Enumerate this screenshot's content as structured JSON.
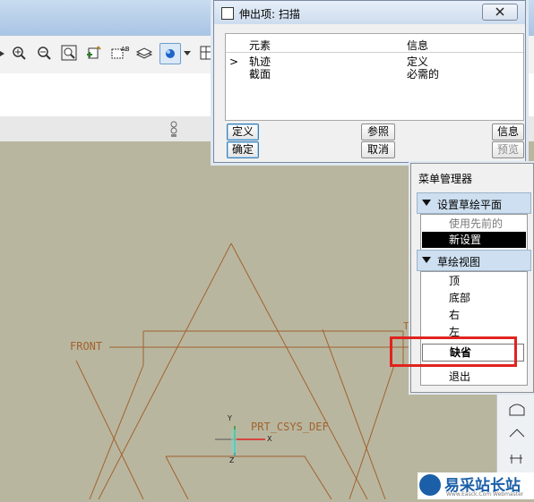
{
  "toolbar": {
    "icons": [
      "zoom-in-icon",
      "zoom-out-icon",
      "zoom-fit-icon",
      "reorient-icon",
      "named-views-icon",
      "layers-icon",
      "display-style-icon",
      "saved-views-icon"
    ]
  },
  "dialog": {
    "title": "伸出项: 扫描",
    "close_label": "关闭",
    "col_element": "元素",
    "col_info": "信息",
    "rows": [
      {
        "marker": ">",
        "element": "轨迹",
        "info": "定义"
      },
      {
        "marker": "",
        "element": "截面",
        "info": "必需的"
      }
    ],
    "buttons": {
      "define": "定义",
      "reference": "参照",
      "info": "信息",
      "ok": "确定",
      "cancel": "取消",
      "preview": "预览"
    }
  },
  "menu_manager": {
    "title": "菜单管理器",
    "section1": {
      "label": "设置草绘平面",
      "items": [
        "使用先前的",
        "新设置"
      ]
    },
    "section2": {
      "label": "草绘视图",
      "items": [
        "顶",
        "底部",
        "右",
        "左",
        "缺省"
      ]
    },
    "exit": "退出"
  },
  "viewport": {
    "datum_front": "FRONT",
    "datum_csys": "PRT_CSYS_DEF",
    "datum_t": "T",
    "axis_y": "Y",
    "axis_x": "X",
    "axis_z": "Z"
  },
  "watermark": {
    "text": "易采站长站",
    "subtext": "Www.Easck.Com Webmaster"
  },
  "colors": {
    "datum": "#a0632f",
    "highlight": "#e0231e",
    "menu_header": "#cddff0",
    "viewport_bg": "#b9b69f"
  }
}
